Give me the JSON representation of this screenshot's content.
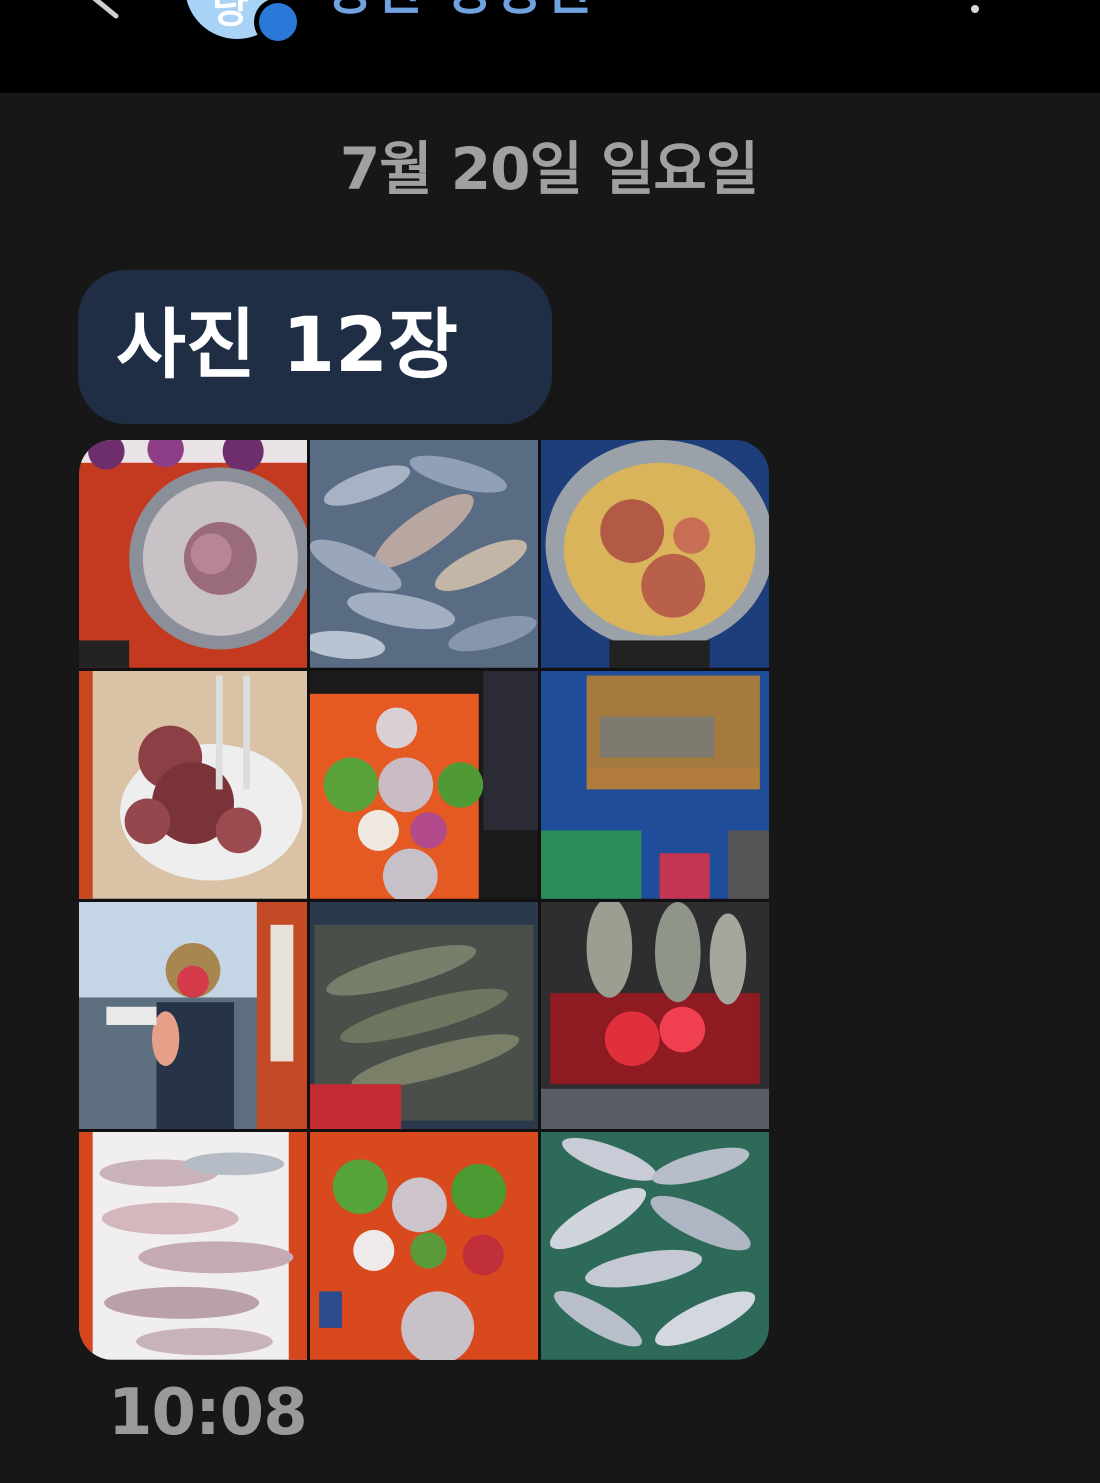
{
  "header": {
    "contact_name": "낭만 낭낭한",
    "avatar_initial": "낭",
    "back_icon": "back-arrow-icon",
    "more_icon": "more-vert-icon"
  },
  "conversation": {
    "date_separator": "7월 20일 일요일",
    "message": {
      "label": "사진 12장",
      "photo_count": 12,
      "time": "10:08",
      "bubble_color": "#1f2d45"
    },
    "photos": [
      {
        "subject": "sliced fish sashimi platter with octopus"
      },
      {
        "subject": "pile of caught mackerel"
      },
      {
        "subject": "ramen pot with octopus"
      },
      {
        "subject": "boiled octopus on plate"
      },
      {
        "subject": "dinner table spread"
      },
      {
        "subject": "fish on deck cutting board"
      },
      {
        "subject": "angler holding red sea bream"
      },
      {
        "subject": "fish on grill"
      },
      {
        "subject": "grilling fish over coals"
      },
      {
        "subject": "filleted fish slices"
      },
      {
        "subject": "table with sashimi and vegetables"
      },
      {
        "subject": "basket of mackerel"
      }
    ]
  },
  "colors": {
    "background": "#171717",
    "topbar": "#000000",
    "accent": "#6fa2df"
  }
}
